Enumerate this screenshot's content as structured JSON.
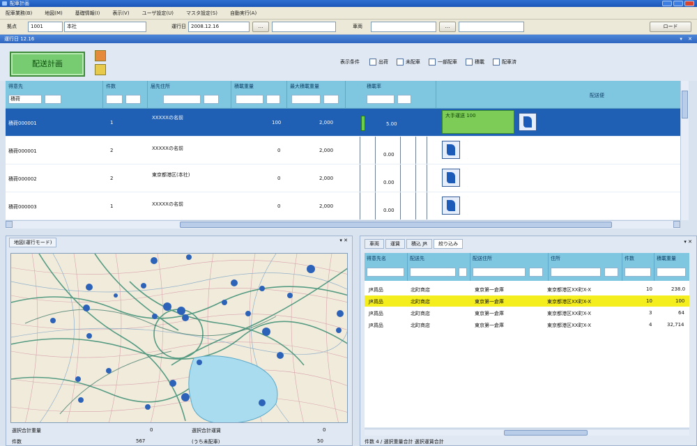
{
  "window": {
    "title": "配車計画"
  },
  "menu": [
    "配車業務(B)",
    "地図(M)",
    "基礎情報(I)",
    "表示(V)",
    "ユーザ設定(U)",
    "マスタ設定(S)",
    "自動実行(A)"
  ],
  "toolbar": {
    "base_label": "拠点",
    "base_code": "1001",
    "base_name": "本社",
    "date_label": "運行日",
    "date_value": "2008.12.16",
    "mid_button": "…",
    "veh_label": "車両",
    "veh_button": "…",
    "load_button": "ロード"
  },
  "top_pane": {
    "title": "運行日 12.16",
    "plan_button": "配送計画",
    "filter_label": "表示条件",
    "filters": [
      "出荷",
      "未配車",
      "一部配車",
      "積載",
      "配車済"
    ]
  },
  "grid": {
    "columns": [
      "得意先",
      "件数",
      "届先住所",
      "積載重量",
      "最大積載重量",
      "積載率",
      "配送便"
    ],
    "filter_first": "積荷",
    "rows": [
      {
        "name": "積荷000001",
        "qty": "1",
        "addr": "XXXXXの名前",
        "weight": "100",
        "max": "2,000",
        "rate": "5.00",
        "assigned": "大手運送 100",
        "selected": true
      },
      {
        "name": "積荷000001",
        "qty": "2",
        "addr": "XXXXXの名前",
        "weight": "0",
        "max": "2,000",
        "rate": "0.00",
        "assigned": "",
        "selected": false
      },
      {
        "name": "積荷000002",
        "qty": "2",
        "addr": "東京都港区(本社)",
        "weight": "0",
        "max": "2,000",
        "rate": "0.00",
        "assigned": "",
        "selected": false
      },
      {
        "name": "積荷000003",
        "qty": "1",
        "addr": "XXXXXの名前",
        "weight": "0",
        "max": "2,000",
        "rate": "0.00",
        "assigned": "",
        "selected": false
      }
    ]
  },
  "map_pane": {
    "title": "地図(運行モード)",
    "foot_l1": "選択合計重量",
    "foot_v1": "0",
    "foot_l2": "選択合計運賃",
    "foot_v2": "0",
    "foot_l3": "件数",
    "foot_v3": "567",
    "foot_l4": "(うち未配車)",
    "foot_v4": "50"
  },
  "list_pane": {
    "tabs": [
      "車両",
      "運賃",
      "積込 JR",
      "絞り込み"
    ],
    "columns": [
      "得意先名",
      "配送先",
      "配送住所",
      "住所",
      "件数",
      "積載重量"
    ],
    "rows": [
      {
        "a": "JR貨品",
        "b": "北町商店",
        "c": "東京第一倉庫",
        "d": "東京都港区XX町X-X",
        "e": "10",
        "f": "238.0",
        "hl": false
      },
      {
        "a": "JR貨品",
        "b": "北町商店",
        "c": "東京第一倉庫",
        "d": "東京都港区XX町X-X",
        "e": "10",
        "f": "100",
        "hl": true
      },
      {
        "a": "JR貨品",
        "b": "北町商店",
        "c": "東京第一倉庫",
        "d": "東京都港区XX町X-X",
        "e": "3",
        "f": "64",
        "hl": false
      },
      {
        "a": "JR貨品",
        "b": "北町商店",
        "c": "東京第一倉庫",
        "d": "東京都港区XX町X-X",
        "e": "4",
        "f": "32,714",
        "hl": false
      }
    ],
    "foot": "件数 4 / 選択重量合計 選択運賃合計"
  },
  "colors": {
    "selected_row": "#1f5fb4",
    "highlight_row": "#f5ee1e",
    "header": "#7fc6e0",
    "plan_button": "#77cc72"
  }
}
